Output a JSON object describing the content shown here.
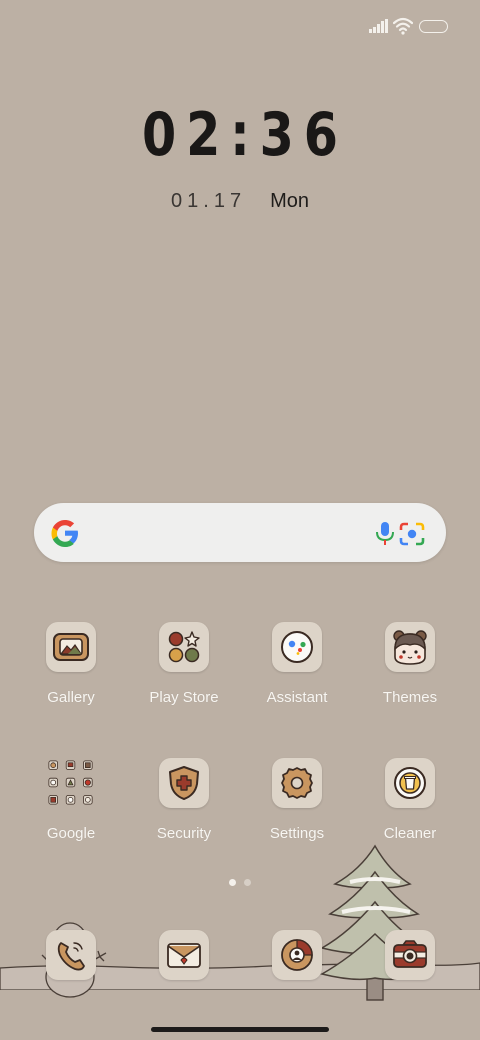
{
  "status_bar": {
    "signal_icon": "signal-icon",
    "wifi_icon": "wifi-icon",
    "battery_icon": "battery-icon"
  },
  "lock": {
    "time": "02:36",
    "date": "01.17",
    "weekday": "Mon"
  },
  "search": {
    "logo_icon": "google-g-icon",
    "mic_icon": "microphone-icon",
    "lens_icon": "google-lens-icon"
  },
  "apps_row1": [
    {
      "label": "Gallery",
      "icon": "gallery-icon"
    },
    {
      "label": "Play Store",
      "icon": "play-store-icon"
    },
    {
      "label": "Assistant",
      "icon": "assistant-icon"
    },
    {
      "label": "Themes",
      "icon": "themes-icon"
    }
  ],
  "apps_row2": [
    {
      "label": "Google",
      "icon": "google-folder-icon"
    },
    {
      "label": "Security",
      "icon": "security-icon"
    },
    {
      "label": "Settings",
      "icon": "settings-icon"
    },
    {
      "label": "Cleaner",
      "icon": "cleaner-icon"
    }
  ],
  "page_indicator": {
    "pages": 2,
    "current": 1
  },
  "dock": [
    {
      "icon": "phone-icon"
    },
    {
      "icon": "messages-icon"
    },
    {
      "icon": "browser-icon"
    },
    {
      "icon": "camera-icon"
    }
  ],
  "colors": {
    "wallpaper": "#bcb0a4",
    "tile": "#ddd4c8",
    "accent_brown": "#b8835a",
    "accent_red": "#9a3b2c"
  }
}
